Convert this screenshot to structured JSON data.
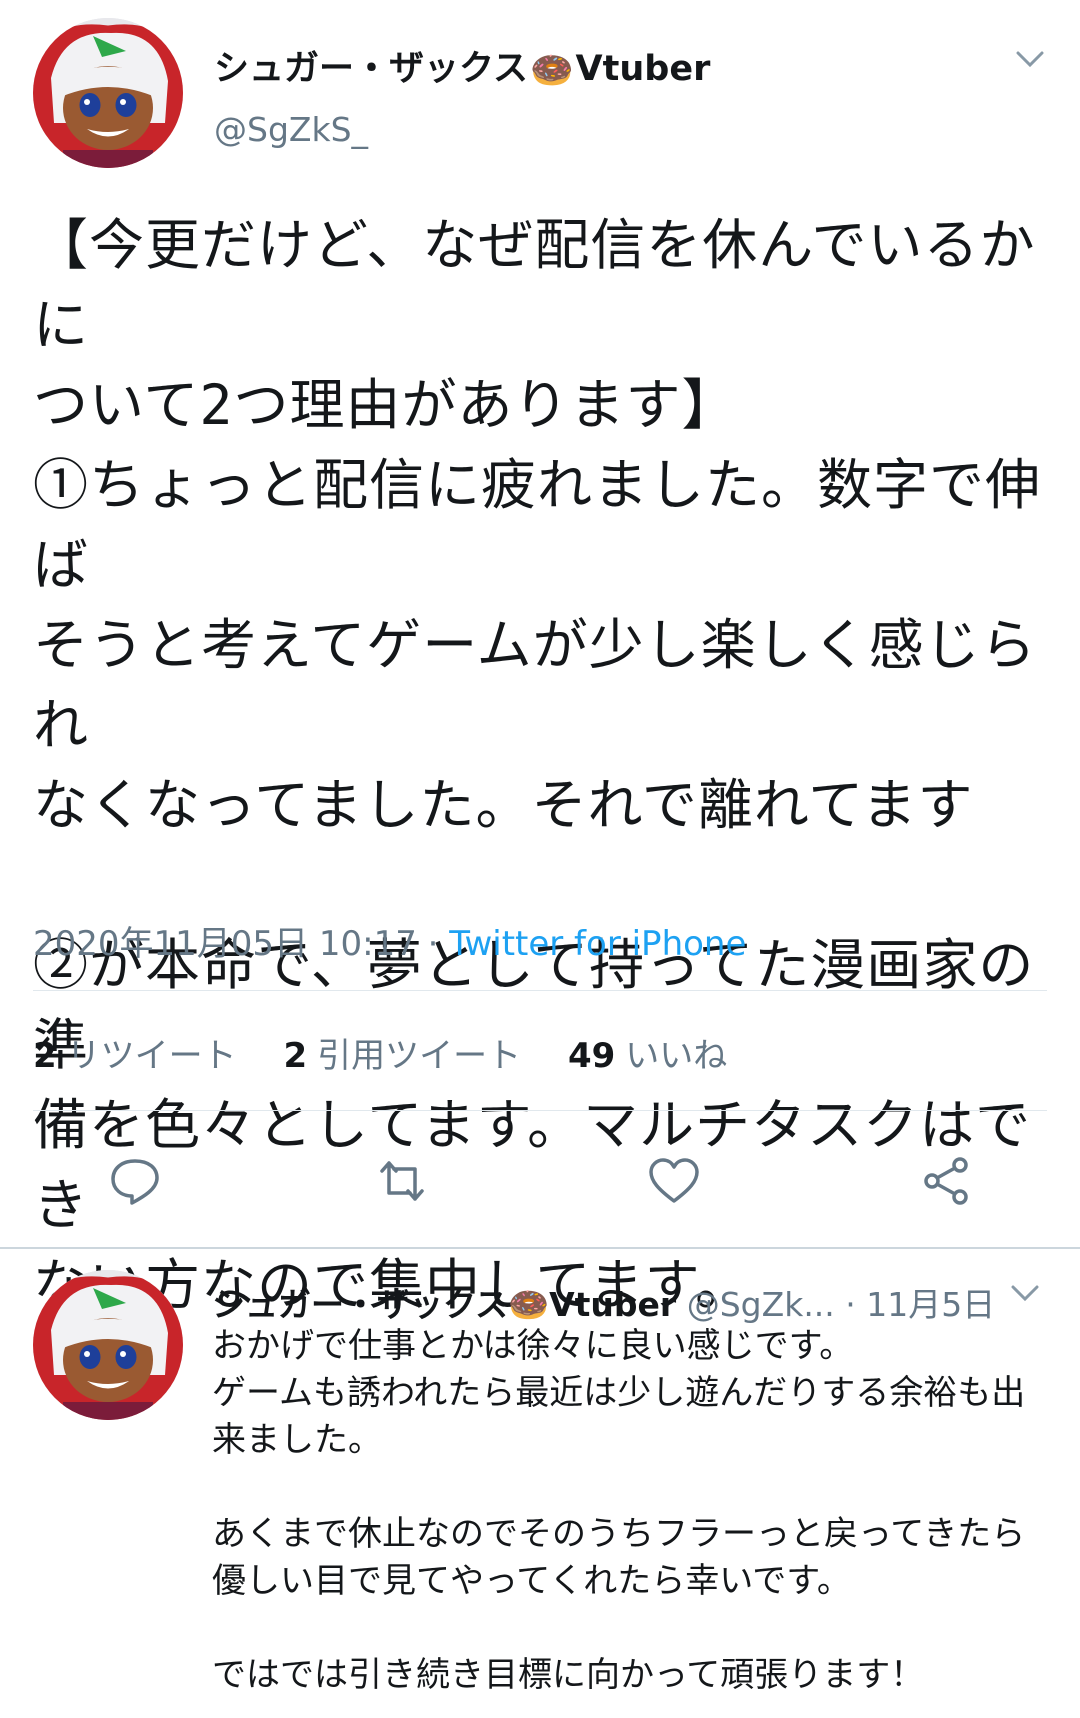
{
  "tweet": {
    "author": {
      "display_name": "シュガー・ザックス",
      "name_emoji": "🍩",
      "name_suffix": "Vtuber",
      "handle": "@SgZkS_"
    },
    "body": "【今更だけど、なぜ配信を休んでいるかに\nついて2つ理由があります】\n①ちょっと配信に疲れました。数字で伸ば\nそうと考えてゲームが少し楽しく感じられ\nなくなってました。それで離れてます\n\n②が本命で、夢として持ってた漫画家の準\n備を色々としてます。マルチタスクはでき\nない方なので集中してます。",
    "timestamp": "2020年11月05日 10:17",
    "separator": " · ",
    "source": "Twitter for iPhone",
    "stats": {
      "retweets": {
        "count": "2",
        "label": "リツイート"
      },
      "quotes": {
        "count": "2",
        "label": "引用ツイート"
      },
      "likes": {
        "count": "49",
        "label": "いいね"
      }
    }
  },
  "actions": [
    {
      "icon": "reply-icon"
    },
    {
      "icon": "retweet-icon"
    },
    {
      "icon": "like-icon"
    },
    {
      "icon": "share-icon"
    }
  ],
  "reply": {
    "author": {
      "display_name": "シュガー・ザックス",
      "name_emoji": "🍩",
      "name_suffix": "Vtuber",
      "handle": "@SgZk...",
      "dot": " · ",
      "date": "11月5日"
    },
    "body": "おかげで仕事とかは徐々に良い感じです。\nゲームも誘われたら最近は少し遊んだりする余裕も出\n来ました。\n\nあくまで休止なのでそのうちフラーっと戻ってきたら\n優しい目で見てやってくれたら幸いです。\n\nではでは引き続き目標に向かって頑張ります！"
  },
  "colors": {
    "secondary_text": "#657786",
    "link": "#1da1f2",
    "divider": "#e1e8ed"
  }
}
